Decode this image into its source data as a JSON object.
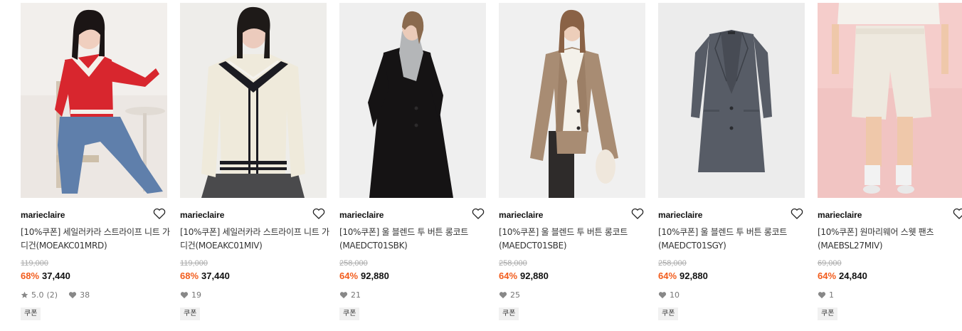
{
  "products": [
    {
      "brand": "marieclaire",
      "name": "[10%쿠폰] 세일러카라 스트라이프 니트 가디건(MOEAKC01MRD)",
      "original_price": "119,000",
      "discount": "68%",
      "price": "37,440",
      "rating": "5.0",
      "review_count": "(2)",
      "likes": "38",
      "coupon": "쿠폰",
      "image": "model-red-cardigan"
    },
    {
      "brand": "marieclaire",
      "name": "[10%쿠폰] 세일러카라 스트라이프 니트 가디건(MOEAKC01MIV)",
      "original_price": "119,000",
      "discount": "68%",
      "price": "37,440",
      "likes": "19",
      "coupon": "쿠폰",
      "image": "model-ivory-cardigan"
    },
    {
      "brand": "marieclaire",
      "name": "[10%쿠폰] 울 블렌드 투 버튼 롱코트(MAEDCT01SBK)",
      "original_price": "258,000",
      "discount": "64%",
      "price": "92,880",
      "likes": "21",
      "coupon": "쿠폰",
      "image": "model-black-coat"
    },
    {
      "brand": "marieclaire",
      "name": "[10%쿠폰] 울 블렌드 투 버튼 롱코트(MAEDCT01SBE)",
      "original_price": "258,000",
      "discount": "64%",
      "price": "92,880",
      "likes": "25",
      "coupon": "쿠폰",
      "image": "model-beige-coat"
    },
    {
      "brand": "marieclaire",
      "name": "[10%쿠폰] 울 블렌드 투 버튼 롱코트(MAEDCT01SGY)",
      "original_price": "258,000",
      "discount": "64%",
      "price": "92,880",
      "likes": "10",
      "coupon": "쿠폰",
      "image": "gray-coat-flat"
    },
    {
      "brand": "marieclaire",
      "name": "[10%쿠폰] 원마리웨어 스웻 팬츠(MAEBSL27MIV)",
      "original_price": "69,000",
      "discount": "64%",
      "price": "24,840",
      "likes": "1",
      "coupon": "쿠폰",
      "image": "model-sweat-shorts"
    }
  ],
  "colors": {
    "discount": "#f25c1c",
    "original_price": "#aaaaaa",
    "coupon_bg": "#f1f1f1"
  },
  "icons": {
    "wishlist": "heart-outline-icon",
    "rating": "star-icon",
    "likes": "heart-filled-icon"
  }
}
